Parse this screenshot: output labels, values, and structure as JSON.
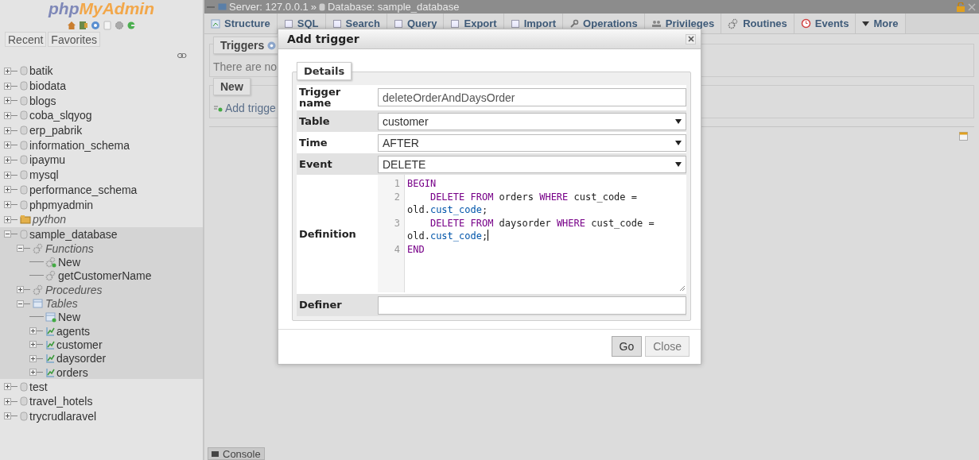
{
  "sidebar": {
    "logo_parts": [
      "php",
      "MyAdmin"
    ],
    "tabs": [
      {
        "label": "Recent"
      },
      {
        "label": "Favorites"
      }
    ],
    "tree": [
      {
        "label": "batik",
        "kind": "database",
        "expanded": false,
        "selected": false
      },
      {
        "label": "biodata",
        "kind": "database",
        "expanded": false,
        "selected": false
      },
      {
        "label": "blogs",
        "kind": "database",
        "expanded": false,
        "selected": false
      },
      {
        "label": "coba_slqyog",
        "kind": "database",
        "expanded": false,
        "selected": false
      },
      {
        "label": "erp_pabrik",
        "kind": "database",
        "expanded": false,
        "selected": false
      },
      {
        "label": "information_schema",
        "kind": "database",
        "expanded": false,
        "selected": false
      },
      {
        "label": "ipaymu",
        "kind": "database",
        "expanded": false,
        "selected": false
      },
      {
        "label": "mysql",
        "kind": "database",
        "expanded": false,
        "selected": false
      },
      {
        "label": "performance_schema",
        "kind": "database",
        "expanded": false,
        "selected": false
      },
      {
        "label": "phpmyadmin",
        "kind": "database",
        "expanded": false,
        "selected": false
      },
      {
        "label": "python",
        "kind": "database-group",
        "expanded": false,
        "selected": false
      },
      {
        "label": "sample_database",
        "kind": "database",
        "expanded": true,
        "selected": true,
        "children": [
          {
            "label": "Functions",
            "kind": "routine-group",
            "expanded": true,
            "children": [
              {
                "label": "New",
                "kind": "new-routine"
              },
              {
                "label": "getCustomerName",
                "kind": "routine"
              }
            ]
          },
          {
            "label": "Procedures",
            "kind": "routine-group",
            "expanded": false
          },
          {
            "label": "Tables",
            "kind": "table-group",
            "expanded": true,
            "children": [
              {
                "label": "New",
                "kind": "new-table"
              },
              {
                "label": "agents",
                "kind": "table",
                "expanded": false
              },
              {
                "label": "customer",
                "kind": "table",
                "expanded": false
              },
              {
                "label": "daysorder",
                "kind": "table",
                "expanded": false
              },
              {
                "label": "orders",
                "kind": "table",
                "expanded": false
              }
            ]
          }
        ]
      },
      {
        "label": "test",
        "kind": "database",
        "expanded": false,
        "selected": false
      },
      {
        "label": "travel_hotels",
        "kind": "database",
        "expanded": false,
        "selected": false
      },
      {
        "label": "trycrudlaravel",
        "kind": "database",
        "expanded": false,
        "selected": false
      }
    ]
  },
  "breadcrumb": {
    "server": "Server: 127.0.0.1",
    "separator": "»",
    "database": "Database: sample_database"
  },
  "tabs": [
    {
      "label": "Structure",
      "kind": "structure"
    },
    {
      "label": "SQL",
      "kind": "sql"
    },
    {
      "label": "Search",
      "kind": "search"
    },
    {
      "label": "Query",
      "kind": "query"
    },
    {
      "label": "Export",
      "kind": "export"
    },
    {
      "label": "Import",
      "kind": "import"
    },
    {
      "label": "Operations",
      "kind": "operations"
    },
    {
      "label": "Privileges",
      "kind": "privileges"
    },
    {
      "label": "Routines",
      "kind": "routines"
    },
    {
      "label": "Events",
      "kind": "events"
    },
    {
      "label": "More",
      "kind": "more"
    }
  ],
  "triggers_panel": {
    "legend": "Triggers",
    "message": "There are no"
  },
  "new_panel": {
    "legend": "New",
    "link": "Add trigge"
  },
  "console": {
    "label": "Console"
  },
  "dialog": {
    "title": "Add trigger",
    "legend": "Details",
    "fields": [
      {
        "label": "Trigger name",
        "kind": "text",
        "value": "deleteOrderAndDaysOrder"
      },
      {
        "label": "Table",
        "kind": "select",
        "value": "customer"
      },
      {
        "label": "Time",
        "kind": "select",
        "value": "AFTER"
      },
      {
        "label": "Event",
        "kind": "select",
        "value": "DELETE"
      },
      {
        "label": "Definition",
        "kind": "code",
        "lines": [
          {
            "number": "1",
            "cursor": false,
            "tokens": [
              {
                "text": "BEGIN",
                "kind": "keyword"
              }
            ]
          },
          {
            "number": "2",
            "cursor": false,
            "tokens": [
              {
                "text": "    DELETE FROM",
                "kind": "keyword"
              },
              {
                "text": " orders ",
                "kind": "plain"
              },
              {
                "text": "WHERE",
                "kind": "keyword"
              },
              {
                "text": " cust_code = old.",
                "kind": "plain"
              },
              {
                "text": "cust_code",
                "kind": "property"
              },
              {
                "text": ";",
                "kind": "plain"
              }
            ]
          },
          {
            "number": "3",
            "cursor": true,
            "tokens": [
              {
                "text": "    DELETE FROM",
                "kind": "keyword"
              },
              {
                "text": " daysorder ",
                "kind": "plain"
              },
              {
                "text": "WHERE",
                "kind": "keyword"
              },
              {
                "text": " cust_code = old.",
                "kind": "plain"
              },
              {
                "text": "cust_code",
                "kind": "property"
              },
              {
                "text": ";",
                "kind": "plain"
              }
            ]
          },
          {
            "number": "4",
            "cursor": false,
            "tokens": [
              {
                "text": "END",
                "kind": "keyword"
              }
            ]
          }
        ]
      },
      {
        "label": "Definer",
        "kind": "text"
      }
    ],
    "buttons": [
      {
        "label": "Go",
        "kind": "primary"
      },
      {
        "label": "Close",
        "kind": "secondary"
      }
    ]
  }
}
